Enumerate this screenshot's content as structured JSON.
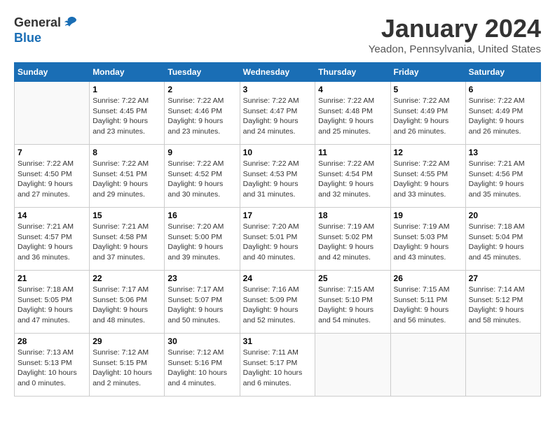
{
  "header": {
    "logo_general": "General",
    "logo_blue": "Blue",
    "month_title": "January 2024",
    "location": "Yeadon, Pennsylvania, United States"
  },
  "calendar": {
    "days_of_week": [
      "Sunday",
      "Monday",
      "Tuesday",
      "Wednesday",
      "Thursday",
      "Friday",
      "Saturday"
    ],
    "weeks": [
      [
        {
          "day": "",
          "info": ""
        },
        {
          "day": "1",
          "info": "Sunrise: 7:22 AM\nSunset: 4:45 PM\nDaylight: 9 hours\nand 23 minutes."
        },
        {
          "day": "2",
          "info": "Sunrise: 7:22 AM\nSunset: 4:46 PM\nDaylight: 9 hours\nand 23 minutes."
        },
        {
          "day": "3",
          "info": "Sunrise: 7:22 AM\nSunset: 4:47 PM\nDaylight: 9 hours\nand 24 minutes."
        },
        {
          "day": "4",
          "info": "Sunrise: 7:22 AM\nSunset: 4:48 PM\nDaylight: 9 hours\nand 25 minutes."
        },
        {
          "day": "5",
          "info": "Sunrise: 7:22 AM\nSunset: 4:49 PM\nDaylight: 9 hours\nand 26 minutes."
        },
        {
          "day": "6",
          "info": "Sunrise: 7:22 AM\nSunset: 4:49 PM\nDaylight: 9 hours\nand 26 minutes."
        }
      ],
      [
        {
          "day": "7",
          "info": "Sunrise: 7:22 AM\nSunset: 4:50 PM\nDaylight: 9 hours\nand 27 minutes."
        },
        {
          "day": "8",
          "info": "Sunrise: 7:22 AM\nSunset: 4:51 PM\nDaylight: 9 hours\nand 29 minutes."
        },
        {
          "day": "9",
          "info": "Sunrise: 7:22 AM\nSunset: 4:52 PM\nDaylight: 9 hours\nand 30 minutes."
        },
        {
          "day": "10",
          "info": "Sunrise: 7:22 AM\nSunset: 4:53 PM\nDaylight: 9 hours\nand 31 minutes."
        },
        {
          "day": "11",
          "info": "Sunrise: 7:22 AM\nSunset: 4:54 PM\nDaylight: 9 hours\nand 32 minutes."
        },
        {
          "day": "12",
          "info": "Sunrise: 7:22 AM\nSunset: 4:55 PM\nDaylight: 9 hours\nand 33 minutes."
        },
        {
          "day": "13",
          "info": "Sunrise: 7:21 AM\nSunset: 4:56 PM\nDaylight: 9 hours\nand 35 minutes."
        }
      ],
      [
        {
          "day": "14",
          "info": "Sunrise: 7:21 AM\nSunset: 4:57 PM\nDaylight: 9 hours\nand 36 minutes."
        },
        {
          "day": "15",
          "info": "Sunrise: 7:21 AM\nSunset: 4:58 PM\nDaylight: 9 hours\nand 37 minutes."
        },
        {
          "day": "16",
          "info": "Sunrise: 7:20 AM\nSunset: 5:00 PM\nDaylight: 9 hours\nand 39 minutes."
        },
        {
          "day": "17",
          "info": "Sunrise: 7:20 AM\nSunset: 5:01 PM\nDaylight: 9 hours\nand 40 minutes."
        },
        {
          "day": "18",
          "info": "Sunrise: 7:19 AM\nSunset: 5:02 PM\nDaylight: 9 hours\nand 42 minutes."
        },
        {
          "day": "19",
          "info": "Sunrise: 7:19 AM\nSunset: 5:03 PM\nDaylight: 9 hours\nand 43 minutes."
        },
        {
          "day": "20",
          "info": "Sunrise: 7:18 AM\nSunset: 5:04 PM\nDaylight: 9 hours\nand 45 minutes."
        }
      ],
      [
        {
          "day": "21",
          "info": "Sunrise: 7:18 AM\nSunset: 5:05 PM\nDaylight: 9 hours\nand 47 minutes."
        },
        {
          "day": "22",
          "info": "Sunrise: 7:17 AM\nSunset: 5:06 PM\nDaylight: 9 hours\nand 48 minutes."
        },
        {
          "day": "23",
          "info": "Sunrise: 7:17 AM\nSunset: 5:07 PM\nDaylight: 9 hours\nand 50 minutes."
        },
        {
          "day": "24",
          "info": "Sunrise: 7:16 AM\nSunset: 5:09 PM\nDaylight: 9 hours\nand 52 minutes."
        },
        {
          "day": "25",
          "info": "Sunrise: 7:15 AM\nSunset: 5:10 PM\nDaylight: 9 hours\nand 54 minutes."
        },
        {
          "day": "26",
          "info": "Sunrise: 7:15 AM\nSunset: 5:11 PM\nDaylight: 9 hours\nand 56 minutes."
        },
        {
          "day": "27",
          "info": "Sunrise: 7:14 AM\nSunset: 5:12 PM\nDaylight: 9 hours\nand 58 minutes."
        }
      ],
      [
        {
          "day": "28",
          "info": "Sunrise: 7:13 AM\nSunset: 5:13 PM\nDaylight: 10 hours\nand 0 minutes."
        },
        {
          "day": "29",
          "info": "Sunrise: 7:12 AM\nSunset: 5:15 PM\nDaylight: 10 hours\nand 2 minutes."
        },
        {
          "day": "30",
          "info": "Sunrise: 7:12 AM\nSunset: 5:16 PM\nDaylight: 10 hours\nand 4 minutes."
        },
        {
          "day": "31",
          "info": "Sunrise: 7:11 AM\nSunset: 5:17 PM\nDaylight: 10 hours\nand 6 minutes."
        },
        {
          "day": "",
          "info": ""
        },
        {
          "day": "",
          "info": ""
        },
        {
          "day": "",
          "info": ""
        }
      ]
    ]
  }
}
